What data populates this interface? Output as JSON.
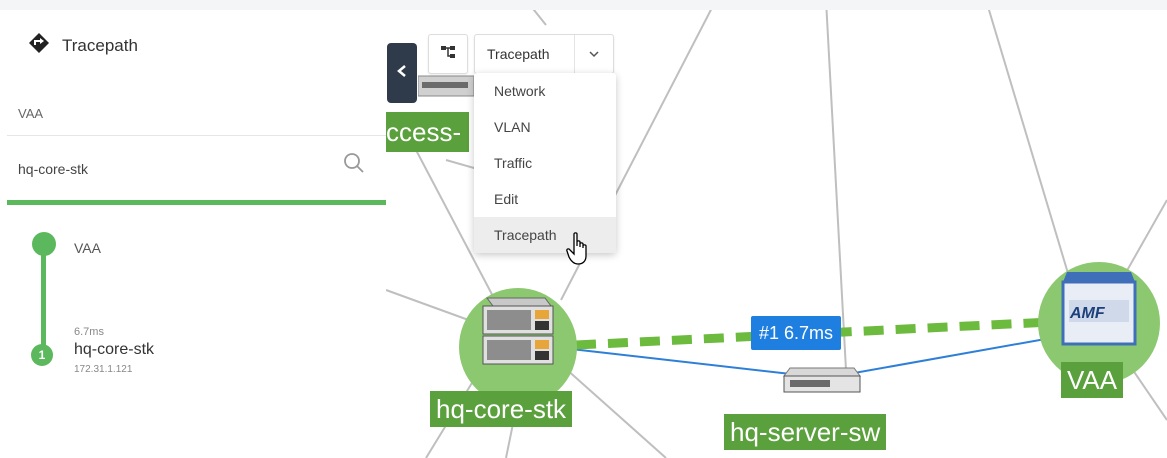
{
  "panel": {
    "title": "Tracepath",
    "from_value": "VAA",
    "search_value": "hq-core-stk",
    "hops": {
      "start_name": "VAA",
      "items": [
        {
          "number": "1",
          "latency": "6.7ms",
          "name": "hq-core-stk",
          "ip": "172.31.1.121"
        }
      ]
    }
  },
  "toolbar": {
    "mode_selected": "Tracepath",
    "menu_items": [
      "Network",
      "VLAN",
      "Traffic",
      "Edit",
      "Tracepath"
    ]
  },
  "map": {
    "partial_node_label": "ccess-",
    "core_node_label": "hq-core-stk",
    "server_node_label": "hq-server-sw",
    "vaa_node_label": "VAA",
    "vaa_device_text": "AMF",
    "link_badge": "#1 6.7ms"
  },
  "colors": {
    "accent_green": "#5cb85c",
    "label_green": "#5aa03c",
    "node_halo": "#8cc870",
    "badge_blue": "#1e7fe0",
    "collapse_dark": "#2f3b4a"
  },
  "icons": {
    "panel_icon": "tracepath-diamond-icon",
    "search": "search-icon",
    "collapse": "chevron-left-icon",
    "tree": "tree-icon",
    "dropdown": "chevron-down-icon"
  }
}
